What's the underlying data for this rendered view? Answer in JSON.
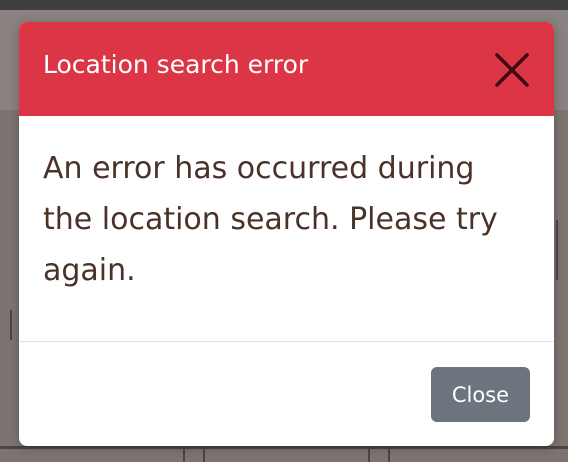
{
  "modal": {
    "title": "Location search error",
    "message": "An error has occurred during the location search. Please try again.",
    "close_button_label": "Close",
    "close_icon": "close-icon"
  },
  "colors": {
    "header": "#dc3545",
    "close_button": "#6c757d",
    "message_text": "#4a3228",
    "backdrop": "#7d7471"
  }
}
